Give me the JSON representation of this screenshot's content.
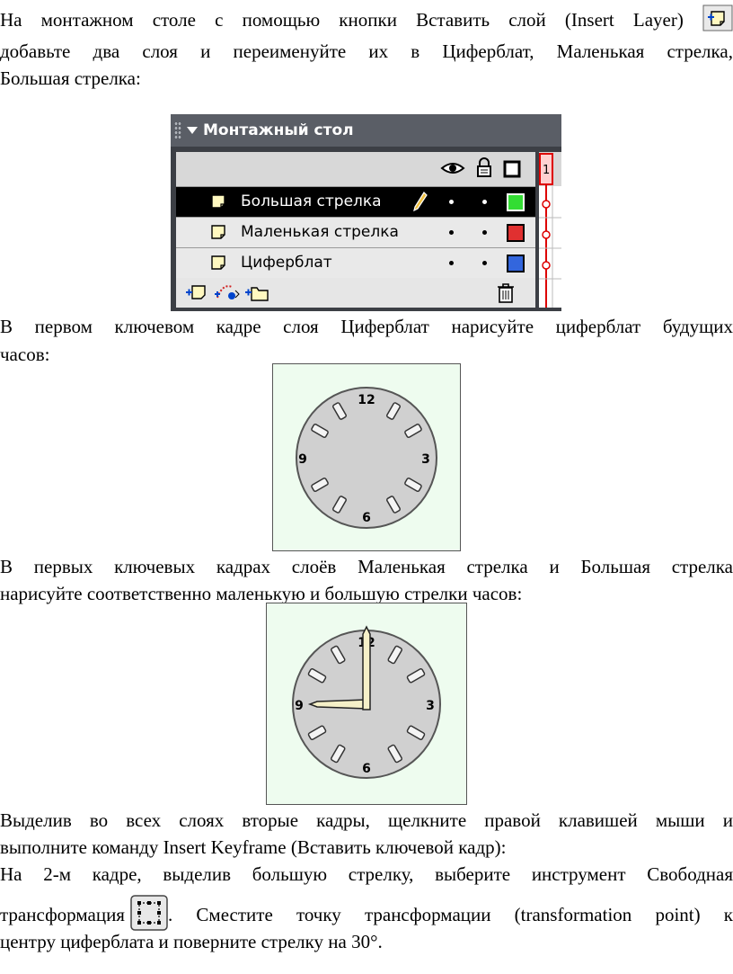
{
  "paragraphs": {
    "p1_line1_a": "На монтажном столе с помощью кнопки Вставить слой (Insert Layer)",
    "p1_line2": "добавьте два слоя и переименуйте их в Циферблат, Маленькая стрелка,",
    "p1_line3": "Большая стрелка:",
    "p2_line1": "В первом ключевом кадре слоя Циферблат нарисуйте циферблат будущих",
    "p2_line2": "часов:",
    "p3_line1": "В первых ключевых кадрах слоёв Маленькая стрелка и Большая стрелка",
    "p3_line2": "нарисуйте соответственно маленькую и большую стрелки часов:",
    "p4_line1": "Выделив во всех слоях вторые кадры, щелкните правой клавишей мыши и",
    "p4_line2": "выполните команду Insert Keyframe (Вставить ключевой кадр):",
    "p5_line1": "На 2-м кадре, выделив большую стрелку, выберите инструмент Свободная",
    "p5_line2_a": "трансформация",
    "p5_line2_b": ". Сместите точку трансформации (transformation point) к",
    "p5_line3": "центру циферблата и поверните стрелку на 30°."
  },
  "timeline": {
    "title": "Монтажный стол",
    "frame_number": "1",
    "layers": [
      {
        "name": "Большая стрелка",
        "selected": true,
        "color": "#33dd33"
      },
      {
        "name": "Маленькая стрелка",
        "selected": false,
        "color": "#e03030"
      },
      {
        "name": "Циферблат",
        "selected": false,
        "color": "#3366dd"
      }
    ]
  },
  "clock": {
    "numbers": [
      "12",
      "3",
      "6",
      "9"
    ],
    "face_color": "#d0d0d0",
    "background_color": "#eefcef",
    "hand_color": "#f5f0c8"
  }
}
